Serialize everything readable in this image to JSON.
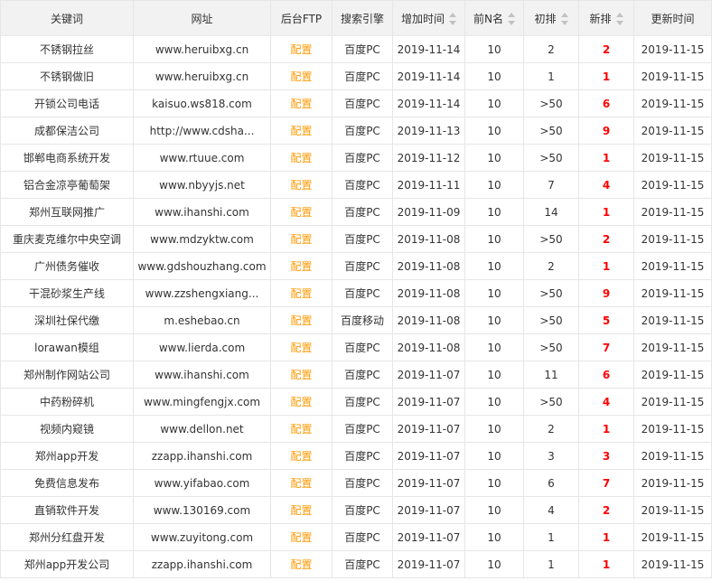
{
  "columns": [
    "关键词",
    "网址",
    "后台FTP",
    "搜索引擎",
    "增加时间",
    "前N名",
    "初排",
    "新排",
    "更新时间"
  ],
  "rows": [
    {
      "keyword": "不锈钢拉丝",
      "url": "www.heruibxg.cn",
      "ftp": "配置",
      "engine": "百度PC",
      "added": "2019-11-14",
      "topn": "10",
      "initial": "2",
      "new": "2",
      "updated": "2019-11-15"
    },
    {
      "keyword": "不锈钢做旧",
      "url": "www.heruibxg.cn",
      "ftp": "配置",
      "engine": "百度PC",
      "added": "2019-11-14",
      "topn": "10",
      "initial": "1",
      "new": "1",
      "updated": "2019-11-15"
    },
    {
      "keyword": "开锁公司电话",
      "url": "kaisuo.ws818.com",
      "ftp": "配置",
      "engine": "百度PC",
      "added": "2019-11-14",
      "topn": "10",
      "initial": ">50",
      "new": "6",
      "updated": "2019-11-15"
    },
    {
      "keyword": "成都保洁公司",
      "url": "http://www.cdsha...",
      "ftp": "配置",
      "engine": "百度PC",
      "added": "2019-11-13",
      "topn": "10",
      "initial": ">50",
      "new": "9",
      "updated": "2019-11-15"
    },
    {
      "keyword": "邯郸电商系统开发",
      "url": "www.rtuue.com",
      "ftp": "配置",
      "engine": "百度PC",
      "added": "2019-11-12",
      "topn": "10",
      "initial": ">50",
      "new": "1",
      "updated": "2019-11-15"
    },
    {
      "keyword": "铝合金凉亭葡萄架",
      "url": "www.nbyyjs.net",
      "ftp": "配置",
      "engine": "百度PC",
      "added": "2019-11-11",
      "topn": "10",
      "initial": "7",
      "new": "4",
      "updated": "2019-11-15"
    },
    {
      "keyword": "郑州互联网推广",
      "url": "www.ihanshi.com",
      "ftp": "配置",
      "engine": "百度PC",
      "added": "2019-11-09",
      "topn": "10",
      "initial": "14",
      "new": "1",
      "updated": "2019-11-15"
    },
    {
      "keyword": "重庆麦克维尔中央空调",
      "url": "www.mdzyktw.com",
      "ftp": "配置",
      "engine": "百度PC",
      "added": "2019-11-08",
      "topn": "10",
      "initial": ">50",
      "new": "2",
      "updated": "2019-11-15"
    },
    {
      "keyword": "广州债务催收",
      "url": "www.gdshouzhang.com",
      "ftp": "配置",
      "engine": "百度PC",
      "added": "2019-11-08",
      "topn": "10",
      "initial": "2",
      "new": "1",
      "updated": "2019-11-15"
    },
    {
      "keyword": "干混砂浆生产线",
      "url": "www.zzshengxiang...",
      "ftp": "配置",
      "engine": "百度PC",
      "added": "2019-11-08",
      "topn": "10",
      "initial": ">50",
      "new": "9",
      "updated": "2019-11-15"
    },
    {
      "keyword": "深圳社保代缴",
      "url": "m.eshebao.cn",
      "ftp": "配置",
      "engine": "百度移动",
      "added": "2019-11-08",
      "topn": "10",
      "initial": ">50",
      "new": "5",
      "updated": "2019-11-15"
    },
    {
      "keyword": "lorawan模组",
      "url": "www.lierda.com",
      "ftp": "配置",
      "engine": "百度PC",
      "added": "2019-11-08",
      "topn": "10",
      "initial": ">50",
      "new": "7",
      "updated": "2019-11-15"
    },
    {
      "keyword": "郑州制作网站公司",
      "url": "www.ihanshi.com",
      "ftp": "配置",
      "engine": "百度PC",
      "added": "2019-11-07",
      "topn": "10",
      "initial": "11",
      "new": "6",
      "updated": "2019-11-15"
    },
    {
      "keyword": "中药粉碎机",
      "url": "www.mingfengjx.com",
      "ftp": "配置",
      "engine": "百度PC",
      "added": "2019-11-07",
      "topn": "10",
      "initial": ">50",
      "new": "4",
      "updated": "2019-11-15"
    },
    {
      "keyword": "视频内窥镜",
      "url": "www.dellon.net",
      "ftp": "配置",
      "engine": "百度PC",
      "added": "2019-11-07",
      "topn": "10",
      "initial": "2",
      "new": "1",
      "updated": "2019-11-15"
    },
    {
      "keyword": "郑州app开发",
      "url": "zzapp.ihanshi.com",
      "ftp": "配置",
      "engine": "百度PC",
      "added": "2019-11-07",
      "topn": "10",
      "initial": "3",
      "new": "3",
      "updated": "2019-11-15"
    },
    {
      "keyword": "免费信息发布",
      "url": "www.yifabao.com",
      "ftp": "配置",
      "engine": "百度PC",
      "added": "2019-11-07",
      "topn": "10",
      "initial": "6",
      "new": "7",
      "updated": "2019-11-15"
    },
    {
      "keyword": "直销软件开发",
      "url": "www.130169.com",
      "ftp": "配置",
      "engine": "百度PC",
      "added": "2019-11-07",
      "topn": "10",
      "initial": "4",
      "new": "2",
      "updated": "2019-11-15"
    },
    {
      "keyword": "郑州分红盘开发",
      "url": "www.zuyitong.com",
      "ftp": "配置",
      "engine": "百度PC",
      "added": "2019-11-07",
      "topn": "10",
      "initial": "1",
      "new": "1",
      "updated": "2019-11-15"
    },
    {
      "keyword": "郑州app开发公司",
      "url": "zzapp.ihanshi.com",
      "ftp": "配置",
      "engine": "百度PC",
      "added": "2019-11-07",
      "topn": "10",
      "initial": "1",
      "new": "1",
      "updated": "2019-11-15"
    }
  ]
}
